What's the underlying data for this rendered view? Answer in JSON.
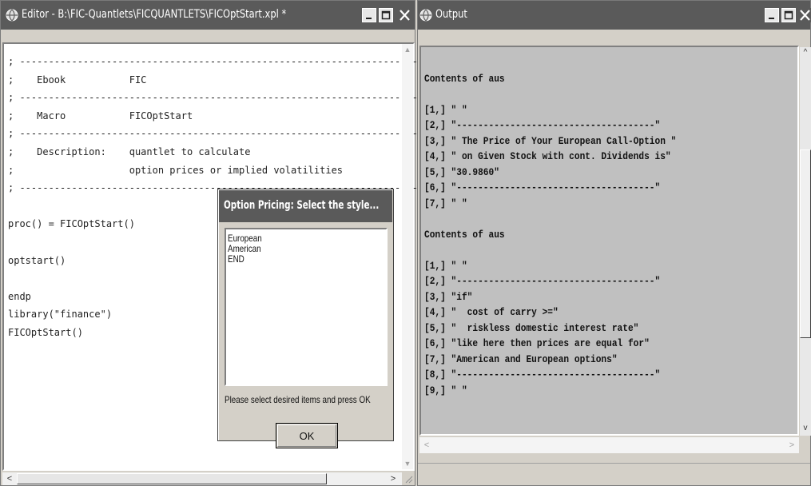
{
  "editor": {
    "title": "Editor - B:\\FIC-Quantlets\\FICQUANTLETS\\FICOptStart.xpl *",
    "lines": [
      "; ----------------------------------------------------------------------",
      ";    Ebook           FIC",
      "; ----------------------------------------------------------------------",
      ";    Macro           FICOptStart",
      "; ----------------------------------------------------------------------",
      ";    Description:    quantlet to calculate",
      ";                    option prices or implied volatilities",
      "; ----------------------------------------------------------------------",
      "",
      "proc() = FICOptStart()",
      "",
      "optstart()",
      "",
      "endp",
      "library(\"finance\")",
      "FICOptStart()"
    ]
  },
  "output": {
    "title": "Output",
    "lines": [
      "",
      "Contents of aus",
      "",
      "[1,] \" \"",
      "[2,] \"-------------------------------------\"",
      "[3,] \" The Price of Your European Call-Option \"",
      "[4,] \" on Given Stock with cont. Dividends is\"",
      "[5,] \"30.9860\"",
      "[6,] \"-------------------------------------\"",
      "[7,] \" \"",
      "",
      "Contents of aus",
      "",
      "[1,] \" \"",
      "[2,] \"-------------------------------------\"",
      "[3,] \"if\"",
      "[4,] \"  cost of carry >=\"",
      "[5,] \"  riskless domestic interest rate\"",
      "[6,] \"like here then prices are equal for\"",
      "[7,] \"American and European options\"",
      "[8,] \"-------------------------------------\"",
      "[9,] \" \""
    ]
  },
  "dialog": {
    "title": "Option Pricing: Select the style...",
    "options": [
      "European",
      "American",
      "END"
    ],
    "prompt": "Please select desired items and press OK",
    "ok_label": "OK"
  },
  "icons": {
    "app": "xplore-globe-icon",
    "minimize": "minimize-icon",
    "maximize": "maximize-icon",
    "close": "close-icon"
  },
  "colors": {
    "titlebar": "#5a5a5a",
    "desktop": "#d4d0c8",
    "output_bg": "#c0c0c0",
    "editor_bg": "#ffffff"
  }
}
